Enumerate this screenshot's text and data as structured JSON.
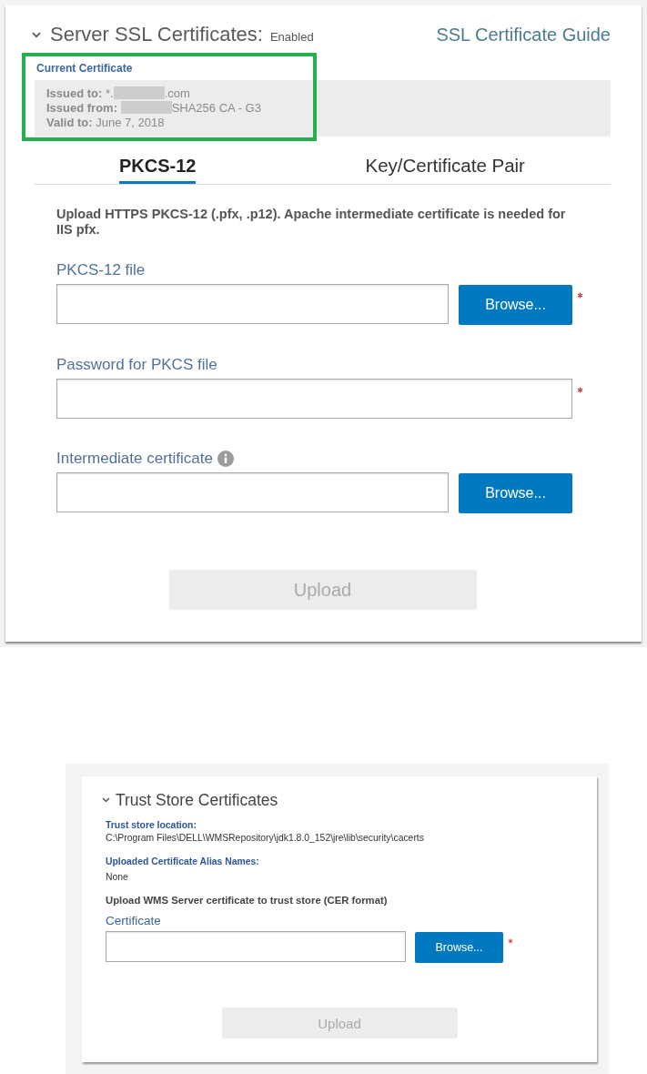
{
  "server_ssl": {
    "title": "Server SSL Certificates:",
    "status": "Enabled",
    "expanded": true,
    "guide_link": "SSL Certificate Guide",
    "current_certificate": {
      "heading": "Current Certificate",
      "highlighted": true,
      "lines": [
        {
          "label": "Issued to:",
          "value_prefix": "*.",
          "redacted": true,
          "value": ".com"
        },
        {
          "label": "Issued from:",
          "redacted": true,
          "value": "SHA256 CA - G3"
        },
        {
          "label": "Valid to:",
          "redacted": false,
          "value": "June 7, 2018"
        }
      ]
    },
    "tabs": [
      {
        "label": "PKCS-12",
        "selected": true
      },
      {
        "label": "Key/Certificate Pair",
        "selected": false
      }
    ],
    "description": "Upload HTTPS PKCS-12 (.pfx, .p12). Apache intermediate certificate is needed for IIS pfx.",
    "fields": [
      {
        "label": "PKCS-12 file",
        "kind": "file",
        "button": "Browse...",
        "required": true,
        "info": false
      },
      {
        "label": "Password for PKCS file",
        "kind": "password",
        "required": true,
        "info": false
      },
      {
        "label": "Intermediate certificate",
        "kind": "file",
        "button": "Browse...",
        "required": false,
        "info": true
      }
    ],
    "upload_button": {
      "label": "Upload",
      "disabled": true
    }
  },
  "trust_store": {
    "title": "Trust Store Certificates",
    "expanded": true,
    "details": [
      {
        "label": "Trust store location:",
        "value": "C:\\Program Files\\DELL\\WMSRepository\\jdk1.8.0_152\\jre\\lib\\security\\cacerts"
      },
      {
        "label": "Uploaded Certificate Alias Names:",
        "value": "None"
      }
    ],
    "instruction": "Upload WMS Server certificate to trust store (CER format)",
    "field": {
      "label": "Certificate",
      "kind": "file",
      "button": "Browse...",
      "required": true,
      "info": false
    },
    "upload_button": {
      "label": "Upload",
      "disabled": true
    }
  }
}
